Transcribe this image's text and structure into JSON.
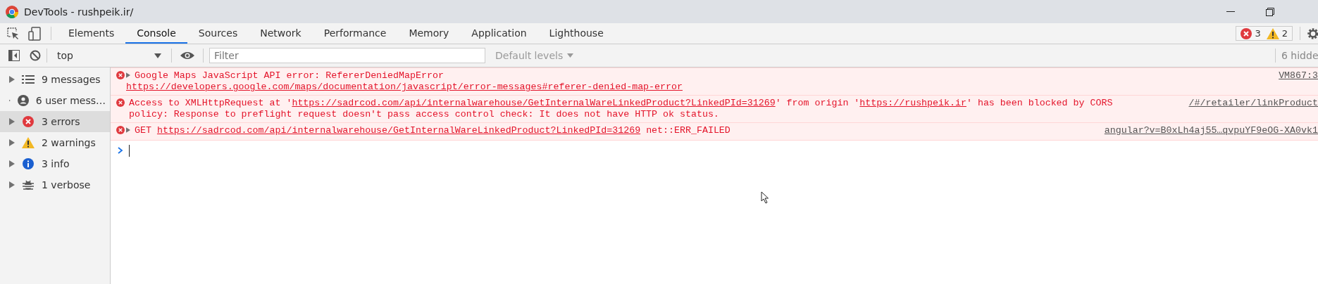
{
  "window": {
    "title": "DevTools - rushpeik.ir/"
  },
  "tabs": [
    {
      "label": "Elements",
      "selected": false
    },
    {
      "label": "Console",
      "selected": true
    },
    {
      "label": "Sources",
      "selected": false
    },
    {
      "label": "Network",
      "selected": false
    },
    {
      "label": "Performance",
      "selected": false
    },
    {
      "label": "Memory",
      "selected": false
    },
    {
      "label": "Application",
      "selected": false
    },
    {
      "label": "Lighthouse",
      "selected": false
    }
  ],
  "issue_counts": {
    "errors": "3",
    "warnings": "2"
  },
  "toolbar": {
    "context": "top",
    "filter": {
      "placeholder": "Filter"
    },
    "levels": "Default levels",
    "hidden_count": "6 hidde"
  },
  "sidebar": {
    "items": [
      {
        "kind": "messages",
        "label": "9 messages",
        "selected": false
      },
      {
        "kind": "user",
        "label": "6 user mess…",
        "selected": false
      },
      {
        "kind": "error",
        "label": "3 errors",
        "selected": true
      },
      {
        "kind": "warning",
        "label": "2 warnings",
        "selected": false
      },
      {
        "kind": "info",
        "label": "3 info",
        "selected": false
      },
      {
        "kind": "verbose",
        "label": "1 verbose",
        "selected": false
      }
    ]
  },
  "messages": [
    {
      "kind": "error",
      "expandable": true,
      "source": "VM867:3",
      "lines": [
        [
          {
            "text": "Google Maps JavaScript API error: RefererDeniedMapError",
            "link": false
          }
        ],
        [
          {
            "text": "https://developers.google.com/maps/documentation/javascript/error-messages#referer-denied-map-error",
            "link": true
          }
        ]
      ]
    },
    {
      "kind": "error",
      "expandable": false,
      "source": "/#/retailer/linkProduct",
      "lines": [
        [
          {
            "text": "Access to XMLHttpRequest at '",
            "link": false
          },
          {
            "text": "https://sadrcod.com/api/internalwarehouse/GetInternalWareLinkedProduct?LinkedPId=31269",
            "link": true
          },
          {
            "text": "' from origin '",
            "link": false
          },
          {
            "text": "https://rushpeik.ir",
            "link": true
          },
          {
            "text": "' has been blocked by CORS",
            "link": false
          }
        ],
        [
          {
            "text": "policy: Response to preflight request doesn't pass access control check: It does not have HTTP ok status.",
            "link": false
          }
        ]
      ]
    },
    {
      "kind": "error",
      "expandable": true,
      "source": "angular?v=B0xLh4aj55…qvpuYF9eOG-XA0vk1",
      "lines": [
        [
          {
            "text": "GET ",
            "link": false
          },
          {
            "text": "https://sadrcod.com/api/internalwarehouse/GetInternalWareLinkedProduct?LinkedPId=31269",
            "link": true
          },
          {
            "text": " net::ERR_FAILED",
            "link": false
          }
        ]
      ]
    }
  ]
}
